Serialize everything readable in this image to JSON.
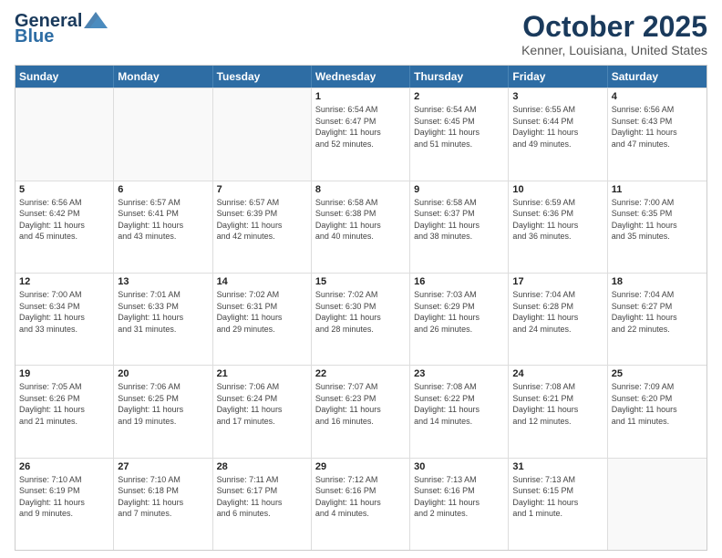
{
  "header": {
    "logo_general": "General",
    "logo_blue": "Blue",
    "title": "October 2025",
    "subtitle": "Kenner, Louisiana, United States"
  },
  "days_of_week": [
    "Sunday",
    "Monday",
    "Tuesday",
    "Wednesday",
    "Thursday",
    "Friday",
    "Saturday"
  ],
  "weeks": [
    [
      {
        "day": "",
        "info": ""
      },
      {
        "day": "",
        "info": ""
      },
      {
        "day": "",
        "info": ""
      },
      {
        "day": "1",
        "info": "Sunrise: 6:54 AM\nSunset: 6:47 PM\nDaylight: 11 hours\nand 52 minutes."
      },
      {
        "day": "2",
        "info": "Sunrise: 6:54 AM\nSunset: 6:45 PM\nDaylight: 11 hours\nand 51 minutes."
      },
      {
        "day": "3",
        "info": "Sunrise: 6:55 AM\nSunset: 6:44 PM\nDaylight: 11 hours\nand 49 minutes."
      },
      {
        "day": "4",
        "info": "Sunrise: 6:56 AM\nSunset: 6:43 PM\nDaylight: 11 hours\nand 47 minutes."
      }
    ],
    [
      {
        "day": "5",
        "info": "Sunrise: 6:56 AM\nSunset: 6:42 PM\nDaylight: 11 hours\nand 45 minutes."
      },
      {
        "day": "6",
        "info": "Sunrise: 6:57 AM\nSunset: 6:41 PM\nDaylight: 11 hours\nand 43 minutes."
      },
      {
        "day": "7",
        "info": "Sunrise: 6:57 AM\nSunset: 6:39 PM\nDaylight: 11 hours\nand 42 minutes."
      },
      {
        "day": "8",
        "info": "Sunrise: 6:58 AM\nSunset: 6:38 PM\nDaylight: 11 hours\nand 40 minutes."
      },
      {
        "day": "9",
        "info": "Sunrise: 6:58 AM\nSunset: 6:37 PM\nDaylight: 11 hours\nand 38 minutes."
      },
      {
        "day": "10",
        "info": "Sunrise: 6:59 AM\nSunset: 6:36 PM\nDaylight: 11 hours\nand 36 minutes."
      },
      {
        "day": "11",
        "info": "Sunrise: 7:00 AM\nSunset: 6:35 PM\nDaylight: 11 hours\nand 35 minutes."
      }
    ],
    [
      {
        "day": "12",
        "info": "Sunrise: 7:00 AM\nSunset: 6:34 PM\nDaylight: 11 hours\nand 33 minutes."
      },
      {
        "day": "13",
        "info": "Sunrise: 7:01 AM\nSunset: 6:33 PM\nDaylight: 11 hours\nand 31 minutes."
      },
      {
        "day": "14",
        "info": "Sunrise: 7:02 AM\nSunset: 6:31 PM\nDaylight: 11 hours\nand 29 minutes."
      },
      {
        "day": "15",
        "info": "Sunrise: 7:02 AM\nSunset: 6:30 PM\nDaylight: 11 hours\nand 28 minutes."
      },
      {
        "day": "16",
        "info": "Sunrise: 7:03 AM\nSunset: 6:29 PM\nDaylight: 11 hours\nand 26 minutes."
      },
      {
        "day": "17",
        "info": "Sunrise: 7:04 AM\nSunset: 6:28 PM\nDaylight: 11 hours\nand 24 minutes."
      },
      {
        "day": "18",
        "info": "Sunrise: 7:04 AM\nSunset: 6:27 PM\nDaylight: 11 hours\nand 22 minutes."
      }
    ],
    [
      {
        "day": "19",
        "info": "Sunrise: 7:05 AM\nSunset: 6:26 PM\nDaylight: 11 hours\nand 21 minutes."
      },
      {
        "day": "20",
        "info": "Sunrise: 7:06 AM\nSunset: 6:25 PM\nDaylight: 11 hours\nand 19 minutes."
      },
      {
        "day": "21",
        "info": "Sunrise: 7:06 AM\nSunset: 6:24 PM\nDaylight: 11 hours\nand 17 minutes."
      },
      {
        "day": "22",
        "info": "Sunrise: 7:07 AM\nSunset: 6:23 PM\nDaylight: 11 hours\nand 16 minutes."
      },
      {
        "day": "23",
        "info": "Sunrise: 7:08 AM\nSunset: 6:22 PM\nDaylight: 11 hours\nand 14 minutes."
      },
      {
        "day": "24",
        "info": "Sunrise: 7:08 AM\nSunset: 6:21 PM\nDaylight: 11 hours\nand 12 minutes."
      },
      {
        "day": "25",
        "info": "Sunrise: 7:09 AM\nSunset: 6:20 PM\nDaylight: 11 hours\nand 11 minutes."
      }
    ],
    [
      {
        "day": "26",
        "info": "Sunrise: 7:10 AM\nSunset: 6:19 PM\nDaylight: 11 hours\nand 9 minutes."
      },
      {
        "day": "27",
        "info": "Sunrise: 7:10 AM\nSunset: 6:18 PM\nDaylight: 11 hours\nand 7 minutes."
      },
      {
        "day": "28",
        "info": "Sunrise: 7:11 AM\nSunset: 6:17 PM\nDaylight: 11 hours\nand 6 minutes."
      },
      {
        "day": "29",
        "info": "Sunrise: 7:12 AM\nSunset: 6:16 PM\nDaylight: 11 hours\nand 4 minutes."
      },
      {
        "day": "30",
        "info": "Sunrise: 7:13 AM\nSunset: 6:16 PM\nDaylight: 11 hours\nand 2 minutes."
      },
      {
        "day": "31",
        "info": "Sunrise: 7:13 AM\nSunset: 6:15 PM\nDaylight: 11 hours\nand 1 minute."
      },
      {
        "day": "",
        "info": ""
      }
    ]
  ]
}
